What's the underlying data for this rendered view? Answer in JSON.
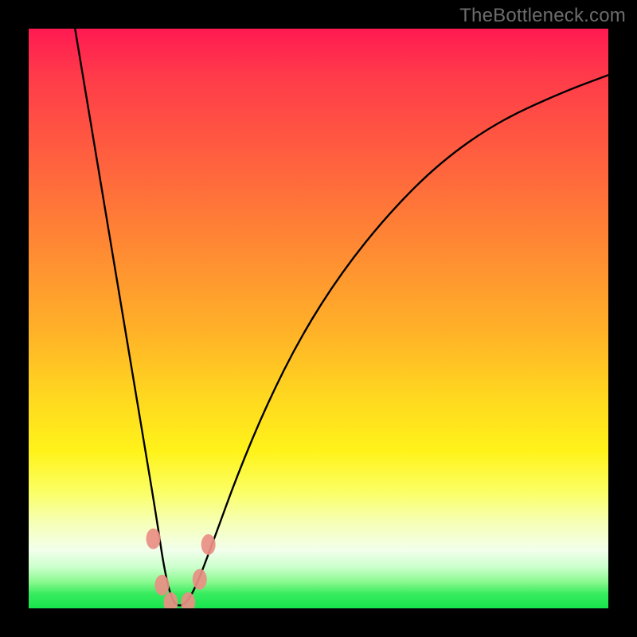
{
  "watermark": {
    "text": "TheBottleneck.com"
  },
  "chart_data": {
    "type": "line",
    "title": "",
    "xlabel": "",
    "ylabel": "",
    "xlim": [
      0,
      100
    ],
    "ylim": [
      0,
      100
    ],
    "grid": false,
    "legend": false,
    "background_gradient": {
      "direction": "vertical",
      "stops": [
        {
          "pos": 0,
          "color": "#ff1a52"
        },
        {
          "pos": 0.22,
          "color": "#ff5f3f"
        },
        {
          "pos": 0.52,
          "color": "#ffb128"
        },
        {
          "pos": 0.73,
          "color": "#fff31a"
        },
        {
          "pos": 0.9,
          "color": "#f2ffec"
        },
        {
          "pos": 0.97,
          "color": "#37ec5e"
        },
        {
          "pos": 1.0,
          "color": "#18e44e"
        }
      ]
    },
    "series": [
      {
        "name": "bottleneck-curve",
        "color": "#000000",
        "x": [
          8,
          10,
          12,
          14,
          16,
          18,
          20,
          22,
          23.5,
          25,
          27,
          29,
          32,
          36,
          41,
          47,
          54,
          62,
          71,
          81,
          92,
          100
        ],
        "y": [
          100,
          88,
          76,
          64,
          52,
          40,
          28,
          16,
          6,
          0.5,
          0.5,
          4,
          12,
          23,
          35,
          47,
          58,
          68,
          77,
          84,
          89,
          92
        ]
      }
    ],
    "markers": [
      {
        "name": "left-upper-marker",
        "x": 21.5,
        "y": 12,
        "color": "#e98f84"
      },
      {
        "name": "left-lower-marker",
        "x": 23.0,
        "y": 4,
        "color": "#e98f84"
      },
      {
        "name": "trough-left-marker",
        "x": 24.5,
        "y": 1,
        "color": "#e98f84"
      },
      {
        "name": "trough-right-marker",
        "x": 27.5,
        "y": 1,
        "color": "#e98f84"
      },
      {
        "name": "right-lower-marker",
        "x": 29.5,
        "y": 5,
        "color": "#e98f84"
      },
      {
        "name": "right-upper-marker",
        "x": 31.0,
        "y": 11,
        "color": "#e98f84"
      }
    ]
  }
}
